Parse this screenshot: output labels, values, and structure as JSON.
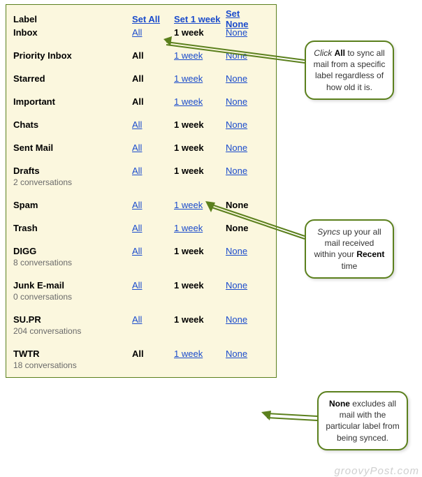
{
  "header": {
    "label": "Label",
    "set_all": "Set All",
    "set_week": "Set 1 week",
    "set_none": "Set None"
  },
  "options": {
    "all": "All",
    "week": "1 week",
    "none": "None"
  },
  "labels": [
    {
      "name": "Inbox",
      "sub": "",
      "selected": "week"
    },
    {
      "name": "Priority Inbox",
      "sub": "",
      "selected": "all"
    },
    {
      "name": "Starred",
      "sub": "",
      "selected": "all"
    },
    {
      "name": "Important",
      "sub": "",
      "selected": "all"
    },
    {
      "name": "Chats",
      "sub": "",
      "selected": "week"
    },
    {
      "name": "Sent Mail",
      "sub": "",
      "selected": "week"
    },
    {
      "name": "Drafts",
      "sub": "2 conversations",
      "selected": "week"
    },
    {
      "name": "Spam",
      "sub": "",
      "selected": "none"
    },
    {
      "name": "Trash",
      "sub": "",
      "selected": "none"
    },
    {
      "name": "DIGG",
      "sub": "8 conversations",
      "selected": "week"
    },
    {
      "name": "Junk E-mail",
      "sub": "0 conversations",
      "selected": "week"
    },
    {
      "name": "SU.PR",
      "sub": "204 conversations",
      "selected": "week"
    },
    {
      "name": "TWTR",
      "sub": "18 conversations",
      "selected": "all"
    }
  ],
  "callouts": {
    "c1": {
      "pre": "Click ",
      "em": "All",
      "post": " to sync all mail from a specific label regardless of how old it is."
    },
    "c2": {
      "pre": "Syncs",
      "post": " up your all mail received within your ",
      "em": "Recent",
      "tail": " time"
    },
    "c3": {
      "em": "None",
      "post": " excludes all mail with the particular label from being synced."
    }
  },
  "watermark": "groovyPost.com"
}
